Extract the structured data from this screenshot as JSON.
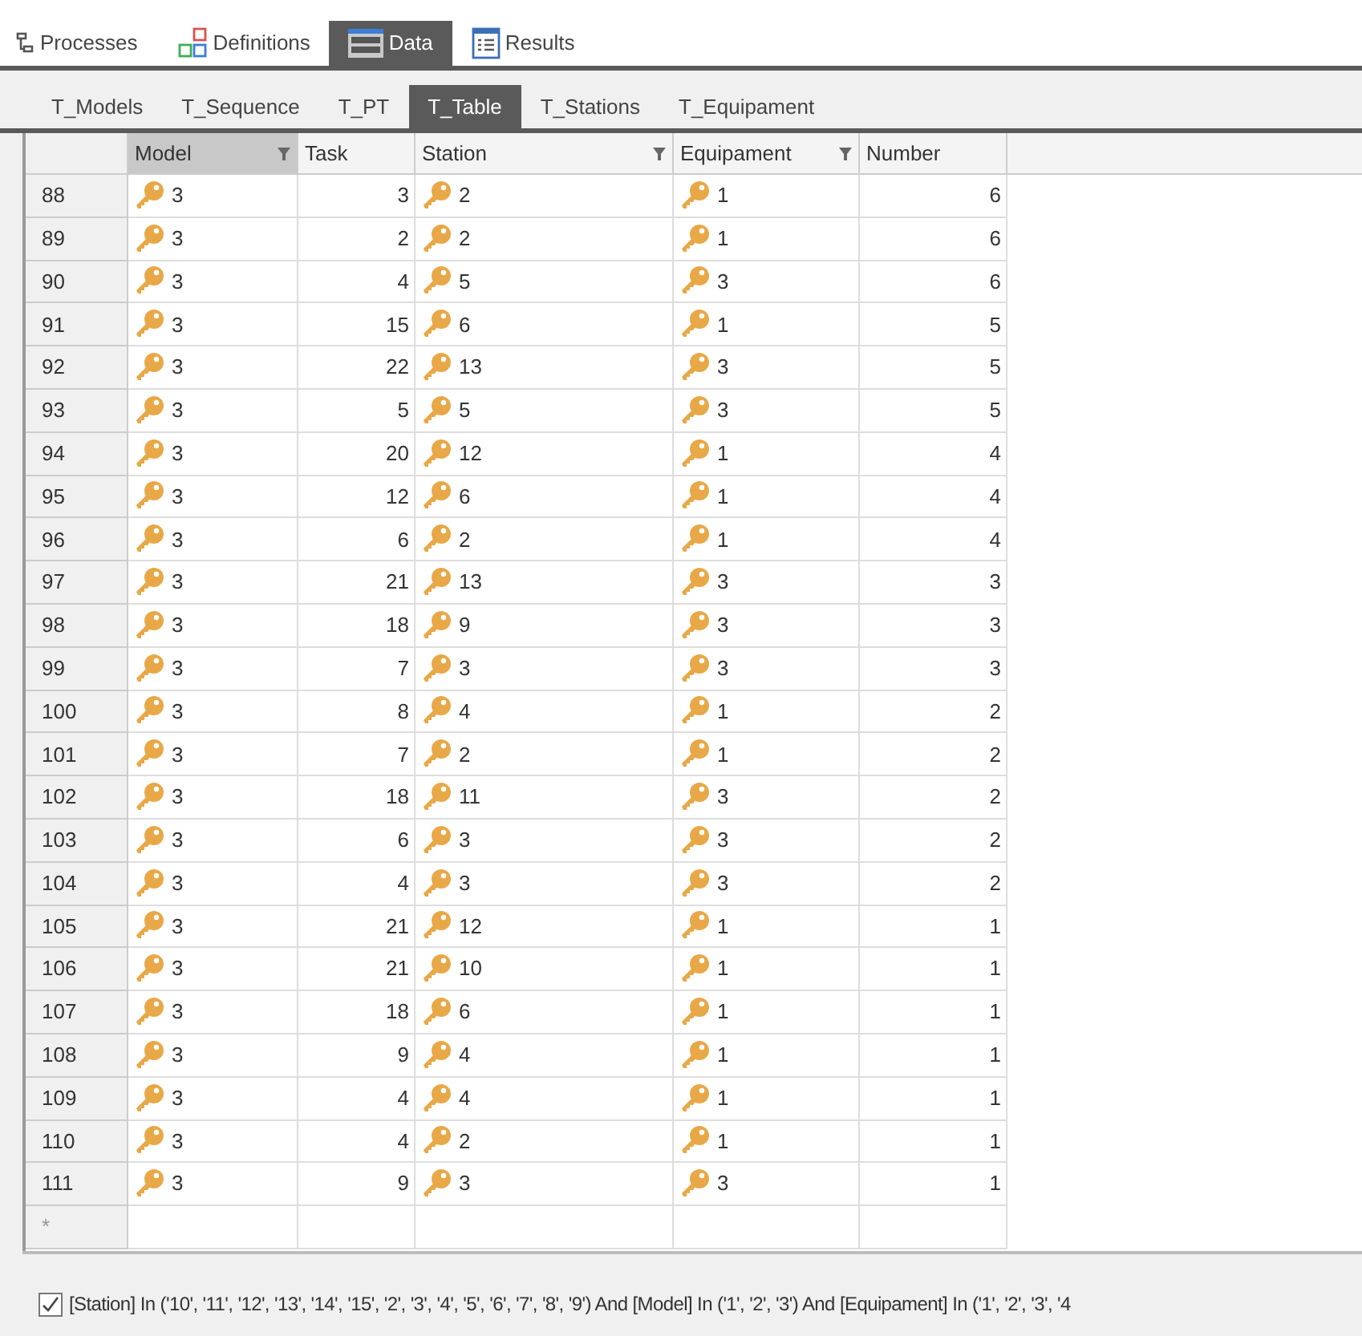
{
  "main_tabs": [
    {
      "label": "Processes",
      "kind": "tree",
      "selected": false
    },
    {
      "label": "Definitions",
      "kind": "squares",
      "selected": false
    },
    {
      "label": "Data",
      "kind": "grid",
      "selected": true
    },
    {
      "label": "Results",
      "kind": "list",
      "selected": false
    }
  ],
  "table_tabs": [
    {
      "label": "T_Models",
      "selected": false
    },
    {
      "label": "T_Sequence",
      "selected": false
    },
    {
      "label": "T_PT",
      "selected": false
    },
    {
      "label": "T_Table",
      "selected": true
    },
    {
      "label": "T_Stations",
      "selected": false
    },
    {
      "label": "T_Equipament",
      "selected": false
    }
  ],
  "table": {
    "columns": [
      {
        "label": "Model",
        "kind": "key",
        "filter": true,
        "selected": true
      },
      {
        "label": "Task",
        "kind": "number",
        "filter": false,
        "selected": false
      },
      {
        "label": "Station",
        "kind": "key",
        "filter": true,
        "selected": false
      },
      {
        "label": "Equipament",
        "kind": "key",
        "filter": true,
        "selected": false
      },
      {
        "label": "Number",
        "kind": "number",
        "filter": false,
        "selected": false
      }
    ],
    "rows": [
      {
        "row": "88",
        "cells": [
          "3",
          "3",
          "2",
          "1",
          "6"
        ]
      },
      {
        "row": "89",
        "cells": [
          "3",
          "2",
          "2",
          "1",
          "6"
        ]
      },
      {
        "row": "90",
        "cells": [
          "3",
          "4",
          "5",
          "3",
          "6"
        ]
      },
      {
        "row": "91",
        "cells": [
          "3",
          "15",
          "6",
          "1",
          "5"
        ]
      },
      {
        "row": "92",
        "cells": [
          "3",
          "22",
          "13",
          "3",
          "5"
        ]
      },
      {
        "row": "93",
        "cells": [
          "3",
          "5",
          "5",
          "3",
          "5"
        ]
      },
      {
        "row": "94",
        "cells": [
          "3",
          "20",
          "12",
          "1",
          "4"
        ]
      },
      {
        "row": "95",
        "cells": [
          "3",
          "12",
          "6",
          "1",
          "4"
        ]
      },
      {
        "row": "96",
        "cells": [
          "3",
          "6",
          "2",
          "1",
          "4"
        ]
      },
      {
        "row": "97",
        "cells": [
          "3",
          "21",
          "13",
          "3",
          "3"
        ]
      },
      {
        "row": "98",
        "cells": [
          "3",
          "18",
          "9",
          "3",
          "3"
        ]
      },
      {
        "row": "99",
        "cells": [
          "3",
          "7",
          "3",
          "3",
          "3"
        ]
      },
      {
        "row": "100",
        "cells": [
          "3",
          "8",
          "4",
          "1",
          "2"
        ]
      },
      {
        "row": "101",
        "cells": [
          "3",
          "7",
          "2",
          "1",
          "2"
        ]
      },
      {
        "row": "102",
        "cells": [
          "3",
          "18",
          "11",
          "3",
          "2"
        ]
      },
      {
        "row": "103",
        "cells": [
          "3",
          "6",
          "3",
          "3",
          "2"
        ]
      },
      {
        "row": "104",
        "cells": [
          "3",
          "4",
          "3",
          "3",
          "2"
        ]
      },
      {
        "row": "105",
        "cells": [
          "3",
          "21",
          "12",
          "1",
          "1"
        ]
      },
      {
        "row": "106",
        "cells": [
          "3",
          "21",
          "10",
          "1",
          "1"
        ]
      },
      {
        "row": "107",
        "cells": [
          "3",
          "18",
          "6",
          "1",
          "1"
        ]
      },
      {
        "row": "108",
        "cells": [
          "3",
          "9",
          "4",
          "1",
          "1"
        ]
      },
      {
        "row": "109",
        "cells": [
          "3",
          "4",
          "4",
          "1",
          "1"
        ]
      },
      {
        "row": "110",
        "cells": [
          "3",
          "4",
          "2",
          "1",
          "1"
        ]
      },
      {
        "row": "111",
        "cells": [
          "3",
          "9",
          "3",
          "3",
          "1"
        ]
      }
    ],
    "new_row_marker": "*"
  },
  "filter": {
    "checked": true,
    "text": "[Station] In ('10', '11', '12', '13', '14', '15', '2', '3', '4', '5', '6', '7', '8', '9') And [Model] In ('1', '2', '3') And [Equipament] In ('1', '2', '3', '4"
  }
}
